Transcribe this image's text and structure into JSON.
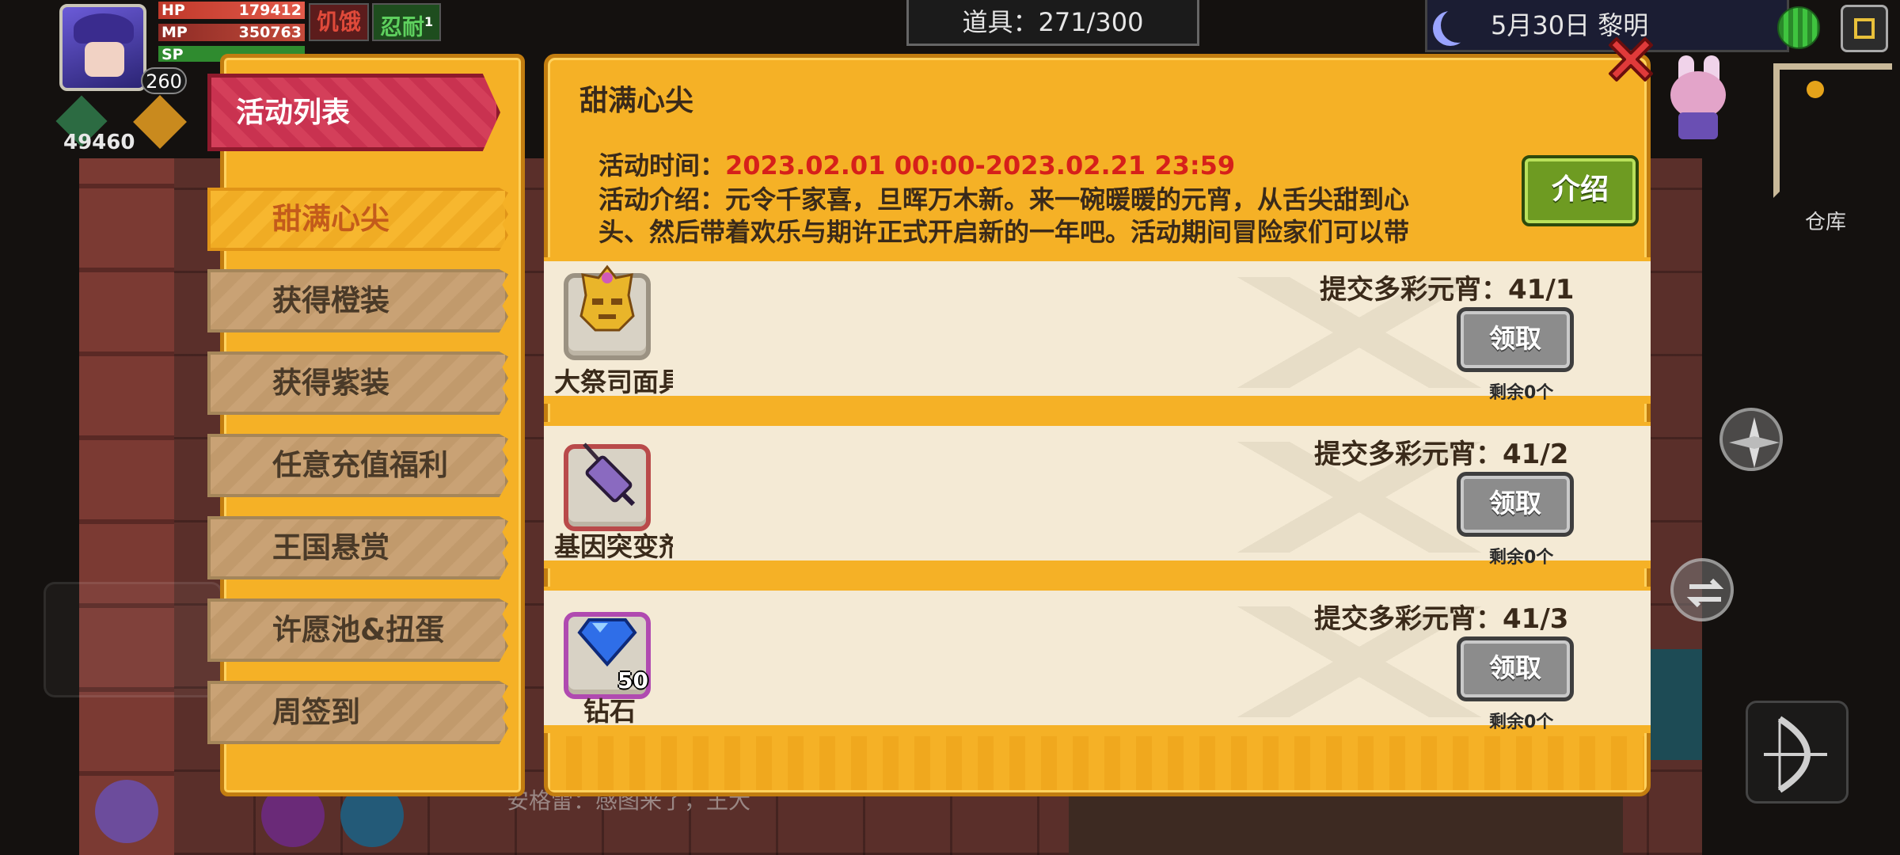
{
  "hud": {
    "hp_label": "HP",
    "hp_value": "179412",
    "mp_label": "MP",
    "mp_value": "350763",
    "sp_label": "SP",
    "level": "260",
    "status_hungry": "饥饿",
    "status_tolerance": "忍耐",
    "status_tolerance_count": "1",
    "currency": "49460",
    "items": "道具：271/300",
    "date": "5月30日 黎明",
    "warehouse": "仓库",
    "bottom_message": "安格雷：感图来了，王大"
  },
  "sidebar": {
    "title": "活动列表",
    "items": [
      {
        "label": "甜满心尖",
        "active": true
      },
      {
        "label": "获得橙装",
        "active": false
      },
      {
        "label": "获得紫装",
        "active": false
      },
      {
        "label": "任意充值福利",
        "active": false
      },
      {
        "label": "王国悬赏",
        "active": false
      },
      {
        "label": "许愿池&扭蛋",
        "active": false
      },
      {
        "label": "周签到",
        "active": false
      }
    ]
  },
  "activity": {
    "title": "甜满心尖",
    "time_label": "活动时间：",
    "time_value": "2023.02.01 00:00-2023.02.21 23:59",
    "desc_line1": "活动介绍：元令千家喜，旦晖万木新。来一碗暖暖的元宵，从舌尖甜到心",
    "desc_line2": "头、然后带着欢乐与期许正式开启新的一年吧。活动期间冒险家们可以带",
    "intro_button": "介绍",
    "tasks": [
      {
        "reward_name": "大祭司面具",
        "reward_icon": "golden-mask-icon",
        "requirement": "提交多彩元宵：41/1",
        "button": "领取",
        "remaining": "剩余0个"
      },
      {
        "reward_name": "基因突变剂",
        "reward_icon": "syringe-icon",
        "requirement": "提交多彩元宵：41/2",
        "button": "领取",
        "remaining": "剩余0个"
      },
      {
        "reward_name": "钻石",
        "reward_icon": "diamond-icon",
        "reward_qty": "50",
        "requirement": "提交多彩元宵：41/3",
        "button": "领取",
        "remaining": "剩余0个"
      }
    ]
  },
  "colors": {
    "panel": "#f5b126",
    "panel_border": "#c27d10",
    "active_tab": "#d43f5a",
    "time_red": "#d6201a",
    "intro_green": "#6e9b22",
    "claim_grey": "#8c8c8c"
  }
}
